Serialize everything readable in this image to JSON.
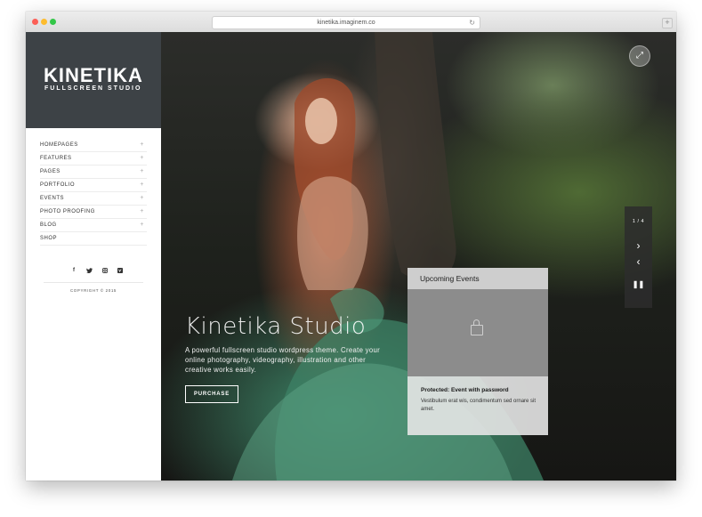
{
  "browser": {
    "url": "kinetika.imaginem.co"
  },
  "sidebar": {
    "logo_title": "KINETIKA",
    "logo_subtitle": "FULLSCREEN STUDIO",
    "menu": [
      {
        "label": "HOMEPAGES",
        "has_submenu": true
      },
      {
        "label": "FEATURES",
        "has_submenu": true
      },
      {
        "label": "PAGES",
        "has_submenu": true
      },
      {
        "label": "PORTFOLIO",
        "has_submenu": true
      },
      {
        "label": "EVENTS",
        "has_submenu": true
      },
      {
        "label": "PHOTO PROOFING",
        "has_submenu": true
      },
      {
        "label": "BLOG",
        "has_submenu": true
      },
      {
        "label": "SHOP",
        "has_submenu": false
      }
    ],
    "social_icons": [
      "facebook-icon",
      "twitter-icon",
      "instagram-icon",
      "vimeo-icon"
    ],
    "copyright": "COPYRIGHT © 2015"
  },
  "hero": {
    "title": "Kinetika Studio",
    "description": "A powerful fullscreen studio wordpress theme. Create your online photography, videography, illustration and other creative works easily.",
    "button_label": "PURCHASE"
  },
  "slider": {
    "counter": "1 / 4"
  },
  "events_widget": {
    "heading": "Upcoming Events",
    "event_title": "Protected: Event with password",
    "event_text": "Vestibulum erat wis, condimentum sed ornare sit amet."
  },
  "colors": {
    "logo_bg": "#3d4246",
    "sidebar_bg": "#ffffff",
    "text_light": "#ffffff"
  }
}
